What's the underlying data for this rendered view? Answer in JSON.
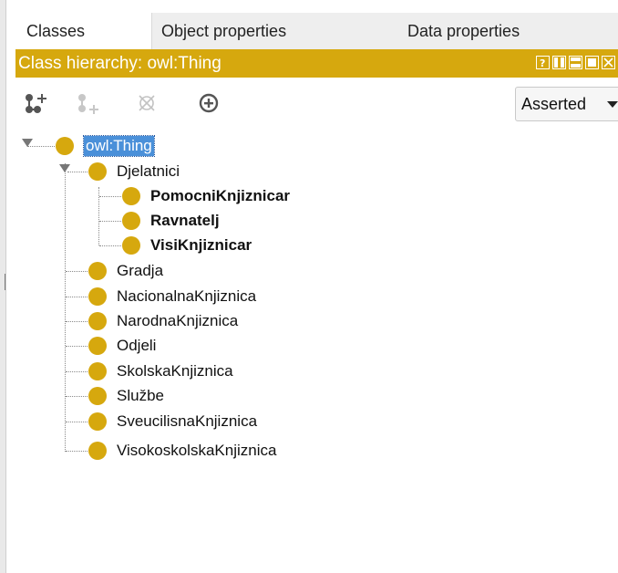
{
  "tabs": [
    {
      "label": "Classes",
      "active": true
    },
    {
      "label": "Object properties",
      "active": false
    },
    {
      "label": "Data properties",
      "active": false
    }
  ],
  "header": {
    "title": "Class hierarchy: owl:Thing",
    "accent_color": "#d6a80e",
    "buttons": [
      "help-icon",
      "split-vertical-icon",
      "split-horizontal-icon",
      "maximize-icon",
      "close-icon"
    ]
  },
  "toolbar": {
    "tools": [
      "add-subclass-icon",
      "add-sibling-class-icon",
      "delete-class-icon",
      "find-usage-icon"
    ],
    "view_mode": "Asserted"
  },
  "tree": {
    "root": "owl:Thing",
    "group": "Djelatnici",
    "group_children": [
      "PomocniKnjiznicar",
      "Ravnatelj",
      "VisiKnjiznicar"
    ],
    "children": [
      "Gradja",
      "NacionalnaKnjiznica",
      "NarodnaKnjiznica",
      "Odjeli",
      "SkolskaKnjiznica",
      "Službe",
      "SveucilisnaKnjiznica",
      "VisokoskolskaKnjiznica"
    ],
    "class_color": "#d6a80e"
  }
}
